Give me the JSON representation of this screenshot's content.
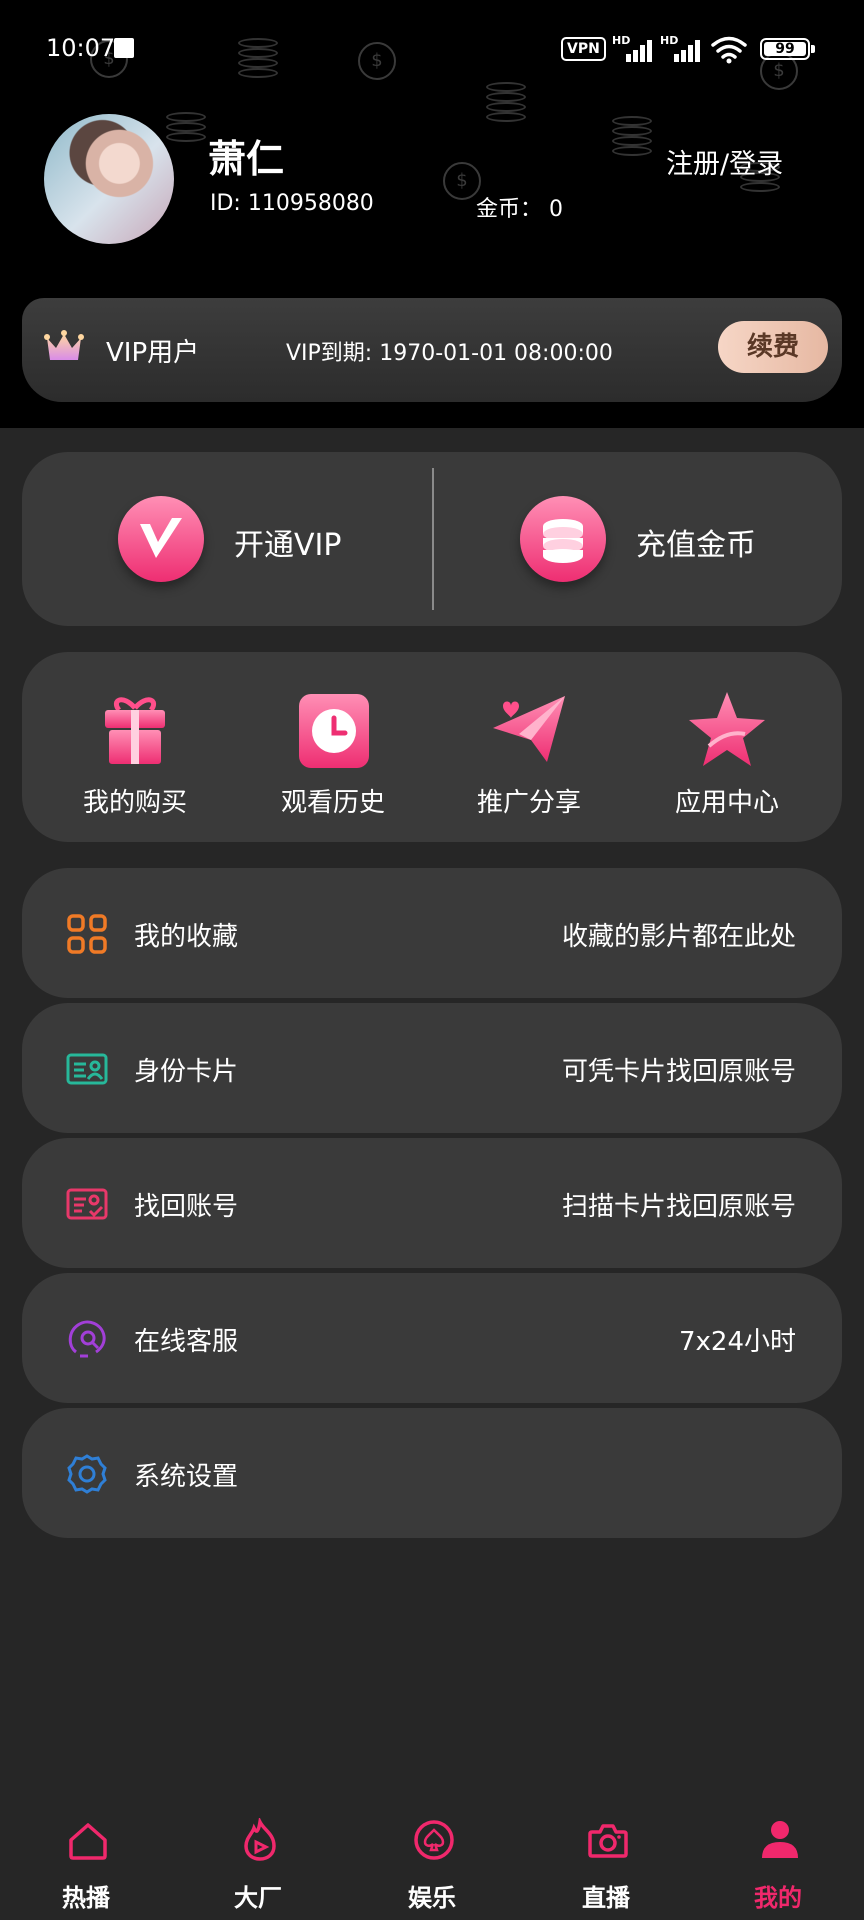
{
  "status_bar": {
    "time": "10:07",
    "vpn": "VPN",
    "hd1": "HD",
    "hd2": "HD",
    "battery": "99"
  },
  "profile": {
    "name": "萧仁",
    "id_text": "ID:  110958080",
    "coins_text": "金币：  0",
    "login_label": "注册/登录"
  },
  "vip_bar": {
    "label": "VIP用户",
    "expiry": "VIP到期: 1970-01-01 08:00:00",
    "renew_label": "续费"
  },
  "quick_actions": [
    {
      "label": "开通VIP",
      "icon": "vip-badge-icon"
    },
    {
      "label": "充值金币",
      "icon": "coin-stack-icon"
    }
  ],
  "features": [
    {
      "label": "我的购买",
      "icon": "gift-icon"
    },
    {
      "label": "观看历史",
      "icon": "clock-icon"
    },
    {
      "label": "推广分享",
      "icon": "paper-plane-icon"
    },
    {
      "label": "应用中心",
      "icon": "star-icon"
    }
  ],
  "menu": [
    {
      "title": "我的收藏",
      "desc": "收藏的影片都在此处",
      "icon": "grid-icon",
      "color": "#f07a26"
    },
    {
      "title": "身份卡片",
      "desc": "可凭卡片找回原账号",
      "icon": "id-card-icon",
      "color": "#27b89a"
    },
    {
      "title": "找回账号",
      "desc": "扫描卡片找回原账号",
      "icon": "card-recover-icon",
      "color": "#e8386a"
    },
    {
      "title": "在线客服",
      "desc": "7x24小时",
      "icon": "headset-icon",
      "color": "#a23fd8"
    },
    {
      "title": "系统设置",
      "desc": "",
      "icon": "gear-icon",
      "color": "#2f7fd6"
    }
  ],
  "tabs": [
    {
      "label": "热播",
      "icon": "home-icon"
    },
    {
      "label": "大厂",
      "icon": "flame-play-icon"
    },
    {
      "label": "娱乐",
      "icon": "spade-icon"
    },
    {
      "label": "直播",
      "icon": "camera-icon"
    },
    {
      "label": "我的",
      "icon": "person-icon",
      "active": true
    }
  ],
  "colors": {
    "accent": "#f0286c",
    "background": "#262626",
    "card": "#3a3a3a",
    "header": "#000000"
  }
}
